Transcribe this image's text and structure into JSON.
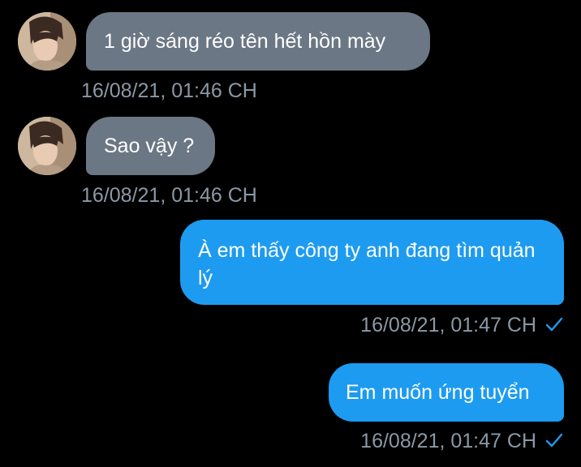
{
  "colors": {
    "background": "#000000",
    "incoming_bubble": "#6b7784",
    "outgoing_bubble": "#1d9bf0",
    "timestamp": "#8b98a5",
    "read_check": "#1d9bf0"
  },
  "messages": [
    {
      "direction": "incoming",
      "text": "1 giờ sáng réo tên hết hồn mày",
      "timestamp": "16/08/21, 01:46 CH",
      "avatar_icon": "profile-photo"
    },
    {
      "direction": "incoming",
      "text": "Sao vậy ?",
      "timestamp": "16/08/21, 01:46 CH",
      "avatar_icon": "profile-photo"
    },
    {
      "direction": "outgoing",
      "text": "À em thấy công ty anh đang tìm quản lý",
      "timestamp": "16/08/21, 01:47 CH",
      "status_icon": "read-check-icon"
    },
    {
      "direction": "outgoing",
      "text": "Em muốn ứng tuyển",
      "timestamp": "16/08/21, 01:47 CH",
      "status_icon": "read-check-icon"
    }
  ]
}
